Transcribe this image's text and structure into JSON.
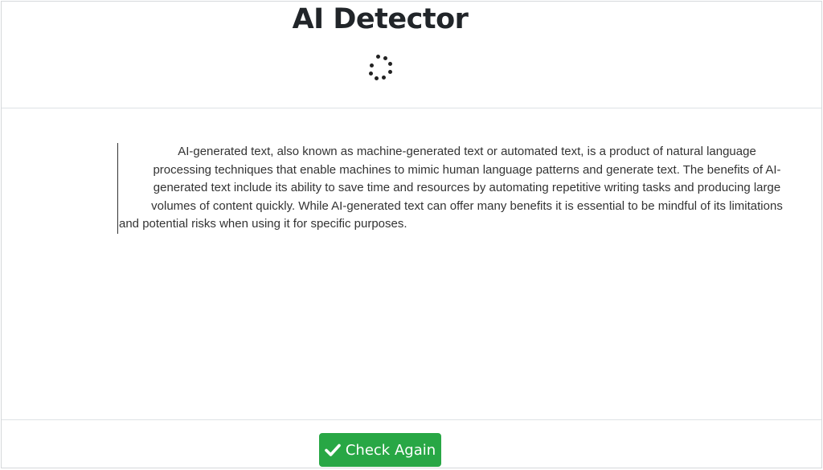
{
  "header": {
    "title": "AI Detector"
  },
  "main": {
    "text_lines": [
      "AI-generated text, also known as machine-generated text or automated text, is a product of natural language",
      "processing techniques that enable machines to mimic human language patterns and generate text. The benefits of AI-",
      "generated text include its ability to save time and resources by automating repetitive writing tasks and producing large",
      "volumes of content quickly. While AI-generated text can offer many benefits it is essential to be mindful of its limitations",
      "and potential risks when using it for specific purposes."
    ]
  },
  "footer": {
    "check_again_label": "Check Again",
    "button_icon": "check-icon"
  },
  "colors": {
    "button_green": "#28a745",
    "title_text": "#212529",
    "body_text": "#333333"
  },
  "spinner_icon": "loading-spinner-icon"
}
